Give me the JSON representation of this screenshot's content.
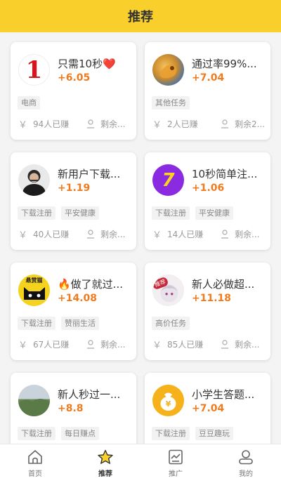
{
  "header": {
    "title": "推荐"
  },
  "tasks": [
    {
      "title": "只需10秒❤️",
      "price": "+6.05",
      "tags": [
        "电商"
      ],
      "earned": "94人已赚",
      "remain": "剩余..."
    },
    {
      "title": "通过率99%...",
      "price": "+7.04",
      "tags": [
        "其他任务"
      ],
      "earned": "2人已赚",
      "remain": "剩余2..."
    },
    {
      "title": "新用户下载...",
      "price": "+1.19",
      "tags": [
        "下载注册",
        "平安健康"
      ],
      "earned": "40人已赚",
      "remain": "剩余..."
    },
    {
      "title": "10秒简单注...",
      "price": "+1.06",
      "tags": [
        "下载注册",
        "平安健康"
      ],
      "earned": "14人已赚",
      "remain": "剩余..."
    },
    {
      "title": "🔥做了就过...",
      "price": "+14.08",
      "tags": [
        "下载注册",
        "赞丽生活"
      ],
      "earned": "67人已赚",
      "remain": "剩余..."
    },
    {
      "title": "新人必做超...",
      "price": "+11.18",
      "tags": [
        "高价任务"
      ],
      "earned": "85人已赚",
      "remain": "剩余..."
    },
    {
      "title": "新人秒过一...",
      "price": "+8.8",
      "tags": [
        "下载注册",
        "每日赚点"
      ],
      "earned": "",
      "remain": ""
    },
    {
      "title": "小学生答题...",
      "price": "+7.04",
      "tags": [
        "下载注册",
        "豆豆趣玩"
      ],
      "earned": "",
      "remain": ""
    }
  ],
  "avatar_texts": {
    "badge_bounty": "悬赏猫",
    "badge_recommend": "推荐",
    "seven": "7",
    "one": "1"
  },
  "tabbar": {
    "items": [
      {
        "label": "首页",
        "icon": "home-icon"
      },
      {
        "label": "推荐",
        "icon": "star-icon"
      },
      {
        "label": "推广",
        "icon": "chart-icon"
      },
      {
        "label": "我的",
        "icon": "user-icon"
      }
    ],
    "active_index": 1
  },
  "colors": {
    "header": "#f9cf2c",
    "price": "#f07b1e"
  }
}
